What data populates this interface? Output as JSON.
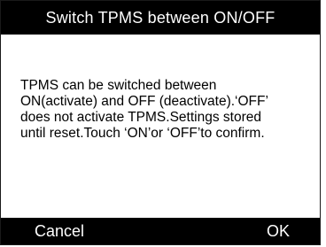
{
  "dialog": {
    "title": "Switch TPMS between ON/OFF",
    "message": "TPMS can be switched between\nON(activate) and OFF (deactivate).‘OFF’\ndoes not activate TPMS.Settings stored\nuntil reset.Touch ‘ON’or ‘OFF’to confirm."
  },
  "buttons": {
    "cancel_label": "Cancel",
    "ok_label": "OK"
  },
  "colors": {
    "bar_background": "#000000",
    "bar_text": "#ffffff",
    "body_background": "#ffffff",
    "body_text": "#000000"
  }
}
